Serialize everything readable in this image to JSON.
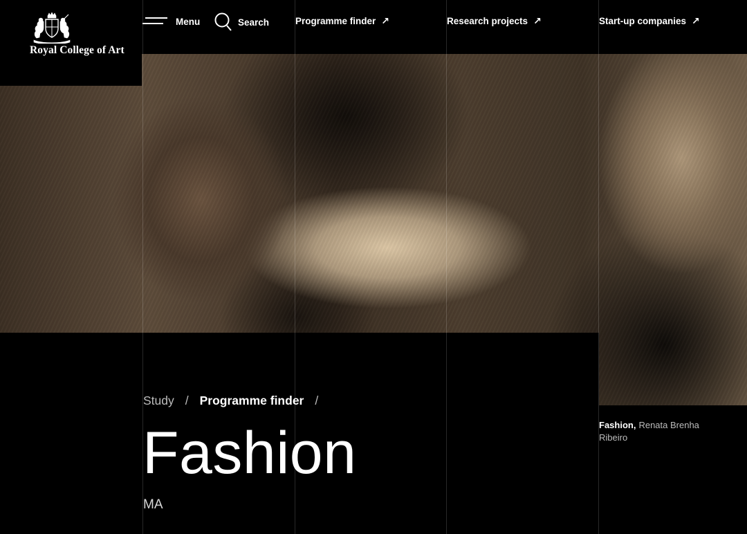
{
  "brand": {
    "name": "Royal College of Art",
    "logo_icon": "royal-crest-icon"
  },
  "nav": {
    "menu_label": "Menu",
    "search_label": "Search",
    "links": [
      {
        "label": "Programme finder",
        "icon": "arrow-up-right-icon"
      },
      {
        "label": "Research projects",
        "icon": "arrow-up-right-icon"
      },
      {
        "label": "Start-up companies",
        "icon": "arrow-up-right-icon"
      }
    ]
  },
  "breadcrumb": {
    "items": [
      "Study",
      "Programme finder"
    ],
    "separator": "/"
  },
  "page": {
    "title": "Fashion",
    "degree": "MA"
  },
  "hero": {
    "caption_title": "Fashion,",
    "caption_credit": "Renata Brenha Ribeiro"
  }
}
